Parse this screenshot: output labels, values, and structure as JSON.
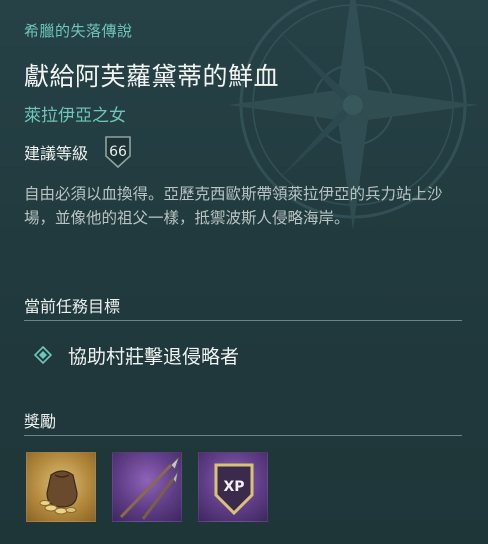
{
  "quest": {
    "category": "希臘的失落傳說",
    "title": "獻給阿芙蘿黛蒂的鮮血",
    "subtitle": "萊拉伊亞之女",
    "level_label": "建議等級",
    "level_value": "66",
    "description": "自由必須以血換得。亞歷克西歐斯帶領萊拉伊亞的兵力站上沙場，並像他的祖父一樣，抵禦波斯人侵略海岸。"
  },
  "objectives": {
    "heading": "當前任務目標",
    "items": [
      {
        "text": "協助村莊擊退侵略者",
        "icon": "diamond-marker-icon"
      }
    ]
  },
  "rewards": {
    "heading": "獎勵",
    "items": [
      {
        "icon": "coin-pouch-icon",
        "color": "#c9a45a"
      },
      {
        "icon": "spear-icon",
        "color": "#6b4a94"
      },
      {
        "icon": "xp-badge-icon",
        "label": "XP",
        "color": "#6b4a94"
      }
    ]
  },
  "colors": {
    "accent": "#6fc5bb",
    "background": "#22393c"
  }
}
